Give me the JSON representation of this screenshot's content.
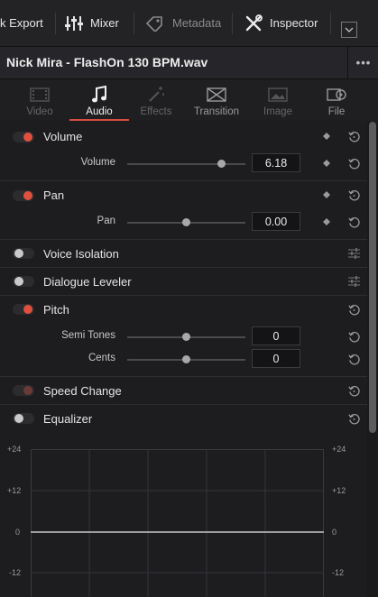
{
  "toolbar": {
    "quick_export": "k Export",
    "mixer": "Mixer",
    "metadata": "Metadata",
    "inspector": "Inspector"
  },
  "clip": {
    "title": "Nick Mira - FlashOn 130 BPM.wav"
  },
  "tabs": [
    {
      "label": "Video",
      "state": "disabled"
    },
    {
      "label": "Audio",
      "state": "active"
    },
    {
      "label": "Effects",
      "state": "disabled"
    },
    {
      "label": "Transition",
      "state": "enabled"
    },
    {
      "label": "Image",
      "state": "disabled"
    },
    {
      "label": "File",
      "state": "enabled"
    }
  ],
  "sections": {
    "volume": {
      "label": "Volume",
      "enabled": true,
      "control_label": "Volume",
      "value": "6.18",
      "slider_fraction": 0.8
    },
    "pan": {
      "label": "Pan",
      "enabled": true,
      "control_label": "Pan",
      "value": "0.00",
      "slider_fraction": 0.5
    },
    "voice_isolation": {
      "label": "Voice Isolation",
      "enabled": false
    },
    "dialogue_leveler": {
      "label": "Dialogue Leveler",
      "enabled": false
    },
    "pitch": {
      "label": "Pitch",
      "enabled": true,
      "semi_tones_label": "Semi Tones",
      "semi_tones_value": "0",
      "semi_tones_fraction": 0.5,
      "cents_label": "Cents",
      "cents_value": "0",
      "cents_fraction": 0.5
    },
    "speed_change": {
      "label": "Speed Change",
      "enabled": true
    },
    "equalizer": {
      "label": "Equalizer",
      "enabled": false
    }
  },
  "eq": {
    "ticks_left": [
      "+24",
      "+12",
      "0",
      "-12"
    ],
    "ticks_right": [
      "+24",
      "+12",
      "0",
      "-12"
    ]
  },
  "colors": {
    "accent": "#e0503f",
    "background": "#1c1c1f"
  }
}
